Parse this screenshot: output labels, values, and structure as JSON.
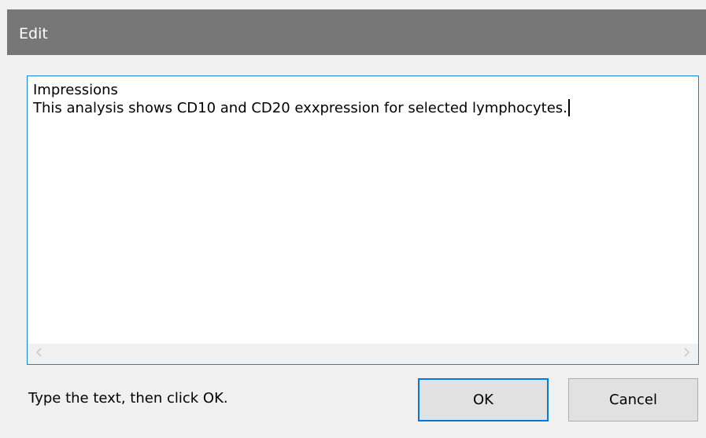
{
  "window": {
    "title": "Edit"
  },
  "editor": {
    "lines": [
      "Impressions",
      "This analysis shows CD10 and CD20 exxpression for selected lymphocytes."
    ]
  },
  "scrollbar": {
    "left_arrow_icon": "chevron-left-icon",
    "right_arrow_icon": "chevron-right-icon"
  },
  "footer": {
    "hint": "Type the text, then click OK."
  },
  "buttons": {
    "ok_label": "OK",
    "cancel_label": "Cancel"
  },
  "colors": {
    "titlebar": "#777777",
    "focus_border": "#0078d7",
    "dialog_background": "#f0f0f0"
  }
}
